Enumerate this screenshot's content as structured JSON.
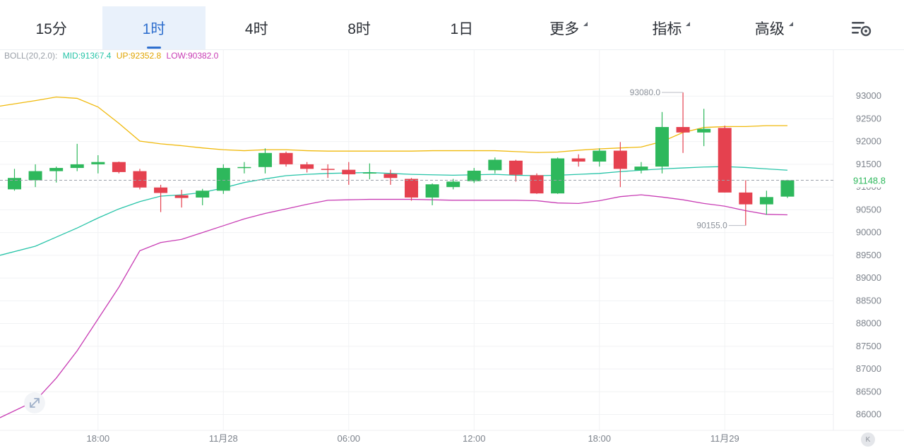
{
  "tabs": [
    {
      "label": "15分",
      "active": false,
      "caret": false
    },
    {
      "label": "1时",
      "active": true,
      "caret": false
    },
    {
      "label": "4时",
      "active": false,
      "caret": false
    },
    {
      "label": "8时",
      "active": false,
      "caret": false
    },
    {
      "label": "1日",
      "active": false,
      "caret": false
    },
    {
      "label": "更多",
      "active": false,
      "caret": true
    },
    {
      "label": "指标",
      "active": false,
      "caret": true
    },
    {
      "label": "高级",
      "active": false,
      "caret": true
    }
  ],
  "settings_icon": "chart-settings-icon",
  "legend": {
    "name": "BOLL(20,2.0):",
    "mid": "MID:91367.4",
    "up": "UP:92352.8",
    "low": "LOW:90382.0"
  },
  "colors": {
    "up": "#2eb85c",
    "down": "#e5414f",
    "mid": "#27c4a8",
    "upper": "#f0b90b",
    "lower": "#c83cb4",
    "active_tab": "#2f6fce"
  },
  "expand_icon": "expand-diagonal-icon",
  "k_badge": "K",
  "chart_data": {
    "type": "candlestick",
    "y_ticks": [
      "86000",
      "86500",
      "87000",
      "87500",
      "88000",
      "88500",
      "89000",
      "89500",
      "90000",
      "90500",
      "91000",
      "91500",
      "92000",
      "92500",
      "93000"
    ],
    "x_ticks": [
      {
        "label": "18:00",
        "index": 4
      },
      {
        "label": "11月28",
        "index": 10
      },
      {
        "label": "06:00",
        "index": 16
      },
      {
        "label": "12:00",
        "index": 22
      },
      {
        "label": "18:00",
        "index": 28
      },
      {
        "label": "11月29",
        "index": 34
      }
    ],
    "ylim": [
      85800,
      93600
    ],
    "last_price": 91148.8,
    "last_price_label": "91148.8",
    "max_marker": {
      "label": "93080.0",
      "value": 93080,
      "index": 32
    },
    "min_marker": {
      "label": "90155.0",
      "value": 90155,
      "index": 35
    },
    "candles": [
      {
        "o": 90950,
        "h": 91400,
        "l": 90920,
        "c": 91200
      },
      {
        "o": 91150,
        "h": 91500,
        "l": 91000,
        "c": 91350
      },
      {
        "o": 91350,
        "h": 91450,
        "l": 91100,
        "c": 91420
      },
      {
        "o": 91420,
        "h": 91950,
        "l": 91350,
        "c": 91500
      },
      {
        "o": 91500,
        "h": 91700,
        "l": 91300,
        "c": 91550
      },
      {
        "o": 91550,
        "h": 91560,
        "l": 91300,
        "c": 91330
      },
      {
        "o": 91350,
        "h": 91400,
        "l": 90950,
        "c": 90990
      },
      {
        "o": 90990,
        "h": 91050,
        "l": 90450,
        "c": 90870
      },
      {
        "o": 90820,
        "h": 90940,
        "l": 90550,
        "c": 90760
      },
      {
        "o": 90770,
        "h": 90960,
        "l": 90600,
        "c": 90920
      },
      {
        "o": 90920,
        "h": 91500,
        "l": 90850,
        "c": 91420
      },
      {
        "o": 91420,
        "h": 91550,
        "l": 91300,
        "c": 91440
      },
      {
        "o": 91440,
        "h": 91850,
        "l": 91300,
        "c": 91750
      },
      {
        "o": 91750,
        "h": 91780,
        "l": 91450,
        "c": 91500
      },
      {
        "o": 91500,
        "h": 91550,
        "l": 91320,
        "c": 91400
      },
      {
        "o": 91400,
        "h": 91500,
        "l": 91200,
        "c": 91380
      },
      {
        "o": 91380,
        "h": 91550,
        "l": 91050,
        "c": 91280
      },
      {
        "o": 91300,
        "h": 91520,
        "l": 91170,
        "c": 91320
      },
      {
        "o": 91290,
        "h": 91380,
        "l": 91050,
        "c": 91200
      },
      {
        "o": 91180,
        "h": 91200,
        "l": 90700,
        "c": 90770
      },
      {
        "o": 90770,
        "h": 91080,
        "l": 90600,
        "c": 91060
      },
      {
        "o": 91000,
        "h": 91180,
        "l": 90950,
        "c": 91120
      },
      {
        "o": 91130,
        "h": 91420,
        "l": 91090,
        "c": 91360
      },
      {
        "o": 91370,
        "h": 91650,
        "l": 91300,
        "c": 91600
      },
      {
        "o": 91580,
        "h": 91600,
        "l": 91120,
        "c": 91270
      },
      {
        "o": 91260,
        "h": 91300,
        "l": 90850,
        "c": 90860
      },
      {
        "o": 90860,
        "h": 91650,
        "l": 90850,
        "c": 91630
      },
      {
        "o": 91630,
        "h": 91720,
        "l": 91450,
        "c": 91560
      },
      {
        "o": 91560,
        "h": 91850,
        "l": 91450,
        "c": 91800
      },
      {
        "o": 91800,
        "h": 91990,
        "l": 91000,
        "c": 91400
      },
      {
        "o": 91370,
        "h": 91550,
        "l": 91300,
        "c": 91450
      },
      {
        "o": 91450,
        "h": 92650,
        "l": 91300,
        "c": 92320
      },
      {
        "o": 92320,
        "h": 93080,
        "l": 91750,
        "c": 92200
      },
      {
        "o": 92200,
        "h": 92720,
        "l": 91900,
        "c": 92280
      },
      {
        "o": 92300,
        "h": 92350,
        "l": 90880,
        "c": 90880
      },
      {
        "o": 90880,
        "h": 91150,
        "l": 90155,
        "c": 90620
      },
      {
        "o": 90620,
        "h": 90920,
        "l": 90390,
        "c": 90780
      },
      {
        "o": 90790,
        "h": 91160,
        "l": 90760,
        "c": 91149
      }
    ],
    "mid_band": [
      89500,
      89700,
      89900,
      90100,
      90320,
      90520,
      90680,
      90800,
      90830,
      90880,
      90980,
      91100,
      91180,
      91250,
      91280,
      91300,
      91310,
      91320,
      91300,
      91280,
      91270,
      91260,
      91270,
      91280,
      91260,
      91250,
      91260,
      91280,
      91300,
      91340,
      91370,
      91400,
      91420,
      91440,
      91450,
      91430,
      91400,
      91370
    ],
    "upper_band": [
      92780,
      92900,
      92980,
      92950,
      92760,
      92400,
      92010,
      91950,
      91910,
      91860,
      91820,
      91800,
      91820,
      91820,
      91800,
      91790,
      91790,
      91790,
      91790,
      91790,
      91800,
      91800,
      91800,
      91800,
      91780,
      91760,
      91770,
      91810,
      91840,
      91860,
      91880,
      92000,
      92200,
      92310,
      92330,
      92330,
      92350,
      92350
    ],
    "lower_band": [
      85930,
      86300,
      86800,
      87400,
      88100,
      88800,
      89600,
      89780,
      89850,
      90000,
      90150,
      90300,
      90420,
      90520,
      90620,
      90710,
      90720,
      90730,
      90730,
      90730,
      90720,
      90710,
      90710,
      90710,
      90710,
      90700,
      90650,
      90640,
      90700,
      90790,
      90830,
      90780,
      90720,
      90640,
      90580,
      90480,
      90400,
      90390
    ]
  }
}
